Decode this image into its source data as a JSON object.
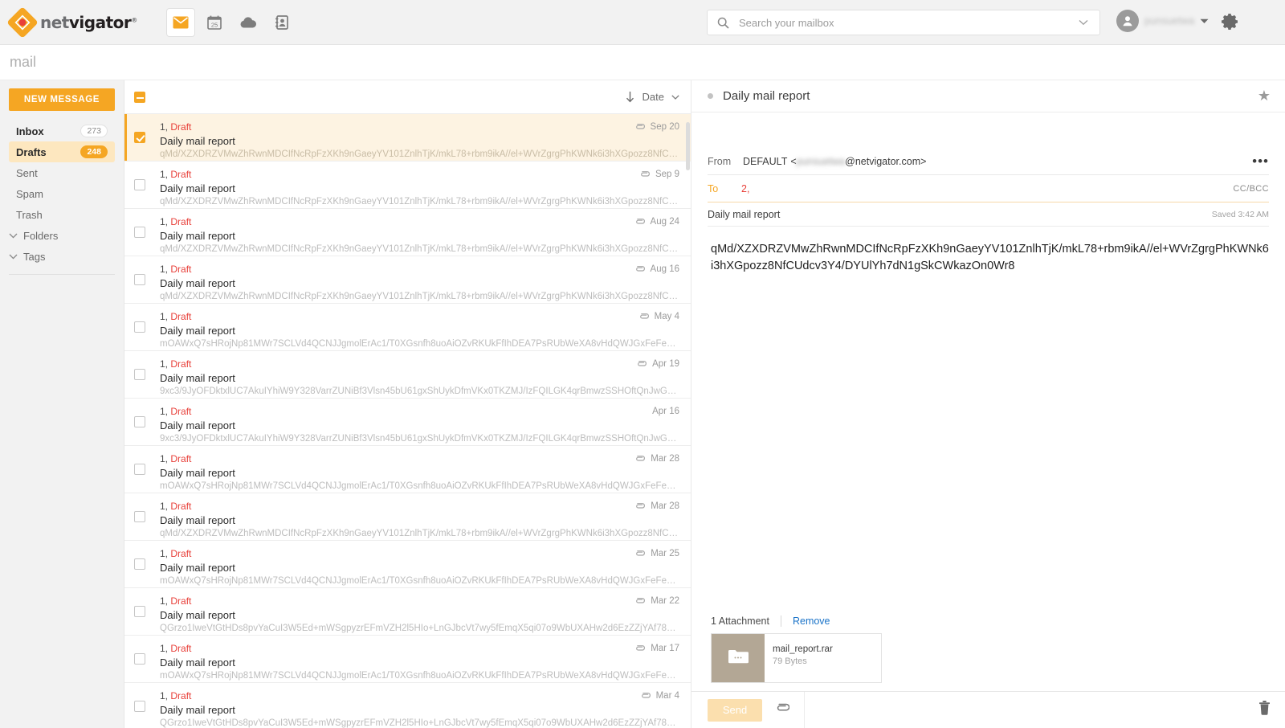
{
  "brand": {
    "name_prefix": "net",
    "name_suffix": "vigator",
    "reg_mark": "®"
  },
  "topbar": {
    "apps": [
      {
        "name": "mail-app-icon",
        "label": "Mail",
        "active": true
      },
      {
        "name": "calendar-app-icon",
        "label": "Calendar",
        "active": false
      },
      {
        "name": "cloud-app-icon",
        "label": "Cloud",
        "active": false
      },
      {
        "name": "contacts-app-icon",
        "label": "Contacts",
        "active": false
      }
    ],
    "search": {
      "placeholder": "Search your mailbox",
      "value": ""
    },
    "username": "punsuetwa",
    "settings_label": "Settings"
  },
  "module": {
    "title": "mail"
  },
  "sidebar": {
    "new_message_label": "NEW MESSAGE",
    "items": [
      {
        "label": "Inbox",
        "count": "273",
        "selected": false,
        "bold": true,
        "accent_badge": false
      },
      {
        "label": "Drafts",
        "count": "248",
        "selected": true,
        "bold": true,
        "accent_badge": true
      },
      {
        "label": "Sent",
        "count": "",
        "selected": false,
        "bold": false,
        "accent_badge": false
      },
      {
        "label": "Spam",
        "count": "",
        "selected": false,
        "bold": false,
        "accent_badge": false
      },
      {
        "label": "Trash",
        "count": "",
        "selected": false,
        "bold": false,
        "accent_badge": false
      }
    ],
    "groups": [
      {
        "label": "Folders"
      },
      {
        "label": "Tags"
      }
    ]
  },
  "list": {
    "sort_label": "Date",
    "sort_direction": "descending",
    "select_all_state": "indeterminate",
    "rows": [
      {
        "count": "1,",
        "status": "Draft",
        "subject": "Daily mail report",
        "snippet": "qMd/XZXDRZVMwZhRwnMDCIfNcRpFzXKh9nGaeyYV101ZnlhTjK/mkL78+rbm9ikA//el+WVrZgrgPhKWNk6i3hXGpozz8NfCUdc...",
        "date": "Sep 20",
        "has_attachment": true,
        "selected": true,
        "checked": true
      },
      {
        "count": "1,",
        "status": "Draft",
        "subject": "Daily mail report",
        "snippet": "qMd/XZXDRZVMwZhRwnMDCIfNcRpFzXKh9nGaeyYV101ZnlhTjK/mkL78+rbm9ikA//el+WVrZgrgPhKWNk6i3hXGpozz8NfCUdc...",
        "date": "Sep 9",
        "has_attachment": true,
        "selected": false,
        "checked": false
      },
      {
        "count": "1,",
        "status": "Draft",
        "subject": "Daily mail report",
        "snippet": "qMd/XZXDRZVMwZhRwnMDCIfNcRpFzXKh9nGaeyYV101ZnlhTjK/mkL78+rbm9ikA//el+WVrZgrgPhKWNk6i3hXGpozz8NfCUdc...",
        "date": "Aug 24",
        "has_attachment": true,
        "selected": false,
        "checked": false
      },
      {
        "count": "1,",
        "status": "Draft",
        "subject": "Daily mail report",
        "snippet": "qMd/XZXDRZVMwZhRwnMDCIfNcRpFzXKh9nGaeyYV101ZnlhTjK/mkL78+rbm9ikA//el+WVrZgrgPhKWNk6i3hXGpozz8NfCUdc...",
        "date": "Aug 16",
        "has_attachment": true,
        "selected": false,
        "checked": false
      },
      {
        "count": "1,",
        "status": "Draft",
        "subject": "Daily mail report",
        "snippet": "mOAWxQ7sHRojNp81MWr7SCLVd4QCNJJgmolErAc1/T0XGsnfh8uoAiOZvRKUkFfIhDEA7PsRUbWeXA8vHdQWJGxFeFe1X1sIr...",
        "date": "May 4",
        "has_attachment": true,
        "selected": false,
        "checked": false
      },
      {
        "count": "1,",
        "status": "Draft",
        "subject": "Daily mail report",
        "snippet": "9xc3/9JyOFDktxlUC7AkuIYhiW9Y328VarrZUNiBf3Vlsn45bU61gxShUykDfmVKx0TKZMJ/IzFQILGK4qrBmwzSSHOftQnJwGnHa...",
        "date": "Apr 19",
        "has_attachment": true,
        "selected": false,
        "checked": false
      },
      {
        "count": "1,",
        "status": "Draft",
        "subject": "Daily mail report",
        "snippet": "9xc3/9JyOFDktxlUC7AkuIYhiW9Y328VarrZUNiBf3Vlsn45bU61gxShUykDfmVKx0TKZMJ/IzFQILGK4qrBmwzSSHOftQnJwGnHa...",
        "date": "Apr 16",
        "has_attachment": false,
        "selected": false,
        "checked": false
      },
      {
        "count": "1,",
        "status": "Draft",
        "subject": "Daily mail report",
        "snippet": "mOAWxQ7sHRojNp81MWr7SCLVd4QCNJJgmolErAc1/T0XGsnfh8uoAiOZvRKUkFfIhDEA7PsRUbWeXA8vHdQWJGxFeFe1X1sIr...",
        "date": "Mar 28",
        "has_attachment": true,
        "selected": false,
        "checked": false
      },
      {
        "count": "1,",
        "status": "Draft",
        "subject": "Daily mail report",
        "snippet": "qMd/XZXDRZVMwZhRwnMDCIfNcRpFzXKh9nGaeyYV101ZnlhTjK/mkL78+rbm9ikA//el+WVrZgrgPhKWNk6i3hXGpozz8NfCUdc...",
        "date": "Mar 28",
        "has_attachment": true,
        "selected": false,
        "checked": false
      },
      {
        "count": "1,",
        "status": "Draft",
        "subject": "Daily mail report",
        "snippet": "mOAWxQ7sHRojNp81MWr7SCLVd4QCNJJgmolErAc1/T0XGsnfh8uoAiOZvRKUkFfIhDEA7PsRUbWeXA8vHdQWJGxFeFe1X1sIr...",
        "date": "Mar 25",
        "has_attachment": true,
        "selected": false,
        "checked": false
      },
      {
        "count": "1,",
        "status": "Draft",
        "subject": "Daily mail report",
        "snippet": "QGrzo1IweVtGtHDs8pvYaCuI3W5Ed+mWSgpyzrEFmVZH2l5HIo+LnGJbcVt7wy5fEmqX5qi07o9WbUXAHw2d6EzZZjYAf7844z/...",
        "date": "Mar 22",
        "has_attachment": true,
        "selected": false,
        "checked": false
      },
      {
        "count": "1,",
        "status": "Draft",
        "subject": "Daily mail report",
        "snippet": "mOAWxQ7sHRojNp81MWr7SCLVd4QCNJJgmolErAc1/T0XGsnfh8uoAiOZvRKUkFfIhDEA7PsRUbWeXA8vHdQWJGxFeFe1X1sIr...",
        "date": "Mar 17",
        "has_attachment": true,
        "selected": false,
        "checked": false
      },
      {
        "count": "1,",
        "status": "Draft",
        "subject": "Daily mail report",
        "snippet": "QGrzo1IweVtGtHDs8pvYaCuI3W5Ed+mWSgpyzrEFmVZH2l5HIo+LnGJbcVt7wy5fEmqX5qi07o9WbUXAHw2d6EzZZjYAf7844z/...",
        "date": "Mar 4",
        "has_attachment": true,
        "selected": false,
        "checked": false
      }
    ]
  },
  "reader": {
    "title": "Daily mail report",
    "from_label": "From",
    "from_profile": "DEFAULT",
    "from_address_user": "punsuetwa",
    "from_address_domain": "@netvigator.com>",
    "from_open_bracket": "<",
    "to_label": "To",
    "to_value": "2,",
    "ccbcc_label": "CC/BCC",
    "subject": "Daily mail report",
    "saved_label": "Saved 3:42 AM",
    "body": "qMd/XZXDRZVMwZhRwnMDCIfNcRpFzXKh9nGaeyYV101ZnlhTjK/mkL78+rbm9ikA//el+WVrZgrgPhKWNk6i3hXGpozz8NfCUdcv3Y4/DYUlYh7dN1gSkCWkazOn0Wr8",
    "attachments": {
      "header": "1 Attachment",
      "remove_label": "Remove",
      "files": [
        {
          "name": "mail_report.rar",
          "size": "79 Bytes"
        }
      ]
    },
    "send_label": "Send"
  },
  "colors": {
    "accent": "#f5a623",
    "draft_red": "#e8403a",
    "link_blue": "#1a73c8",
    "selected_row_bg": "#fdf3e2"
  }
}
